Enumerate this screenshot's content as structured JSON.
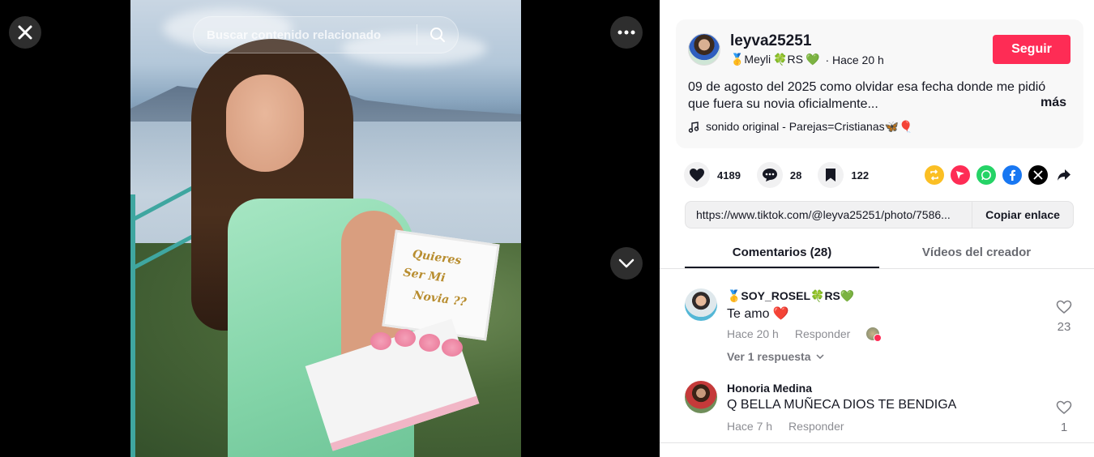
{
  "search": {
    "placeholder": "Buscar contenido relacionado"
  },
  "photo_box_text": {
    "line1": "Quieres",
    "line2": "Ser Mi",
    "line3": "Novia ??"
  },
  "author": {
    "username": "leyva25251",
    "nickname_prefix": "🥇Meyli",
    "nickname_mid": "🍀RS",
    "nickname_suffix": "💚",
    "time": "· Hace 20 h",
    "follow_label": "Seguir"
  },
  "post": {
    "description": "09 de agosto del 2025 como olvidar esa fecha donde me pidió que fuera su novia oficialmente...",
    "more_label": "más",
    "music": "sonido original - Parejas=Cristianas🦋🎈"
  },
  "stats": {
    "likes": "4189",
    "comments": "28",
    "saves": "122"
  },
  "link": {
    "url": "https://www.tiktok.com/@leyva25251/photo/7586...",
    "copy_label": "Copiar enlace"
  },
  "tabs": {
    "comments": "Comentarios (28)",
    "creator_videos": "Vídeos del creador"
  },
  "comments": [
    {
      "user": "🥇SOY_ROSEL🍀RS💚",
      "text": "Te amo ❤️",
      "time": "Hace 20 h",
      "reply_label": "Responder",
      "likes": "23",
      "view_replies": "Ver 1 respuesta"
    },
    {
      "user": "Honoria Medina",
      "text": "Q BELLA MUÑECA DIOS TE BENDIGA",
      "time": "Hace 7 h",
      "reply_label": "Responder",
      "likes": "1"
    }
  ],
  "colors": {
    "follow": "#fe2c55",
    "repost": "#fbbf24",
    "send": "#fe2c55",
    "whatsapp": "#25d366",
    "facebook": "#1877f2",
    "x": "#000000"
  }
}
